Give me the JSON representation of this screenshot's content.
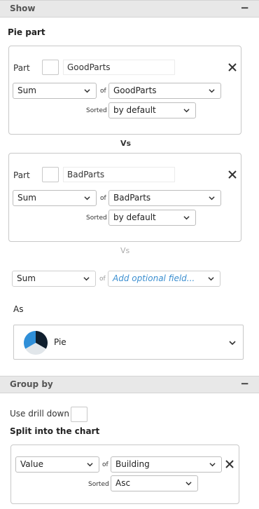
{
  "show_section": {
    "title": "Show",
    "collapse": "−"
  },
  "pie_part_label": "Pie part",
  "parts": [
    {
      "part_label": "Part",
      "name": "GoodParts",
      "aggregate": "Sum",
      "of_label": "of",
      "field": "GoodParts",
      "sorted_label": "Sorted",
      "sort": "by default"
    },
    {
      "part_label": "Part",
      "name": "BadParts",
      "aggregate": "Sum",
      "of_label": "of",
      "field": "BadParts",
      "sorted_label": "Sorted",
      "sort": "by default"
    }
  ],
  "vs_label": "Vs",
  "vs_label_2": "Vs",
  "optional": {
    "aggregate": "Sum",
    "of_label": "of",
    "placeholder": "Add optional field..."
  },
  "as_label": "As",
  "chart_type": {
    "label": "Pie",
    "icon": "pie-chart-icon"
  },
  "group_section": {
    "title": "Group by",
    "collapse": "−"
  },
  "drill_down_label": "Use drill down",
  "split_label": "Split into the chart",
  "split": {
    "aggregate": "Value",
    "of_label": "of",
    "field": "Building",
    "sorted_label": "Sorted",
    "sort": "Asc"
  },
  "colors": {
    "accent": "#3c8fd0",
    "pie_dark": "#0f1f2e",
    "pie_blue": "#2f8fd8",
    "pie_light": "#e1e6ea"
  }
}
